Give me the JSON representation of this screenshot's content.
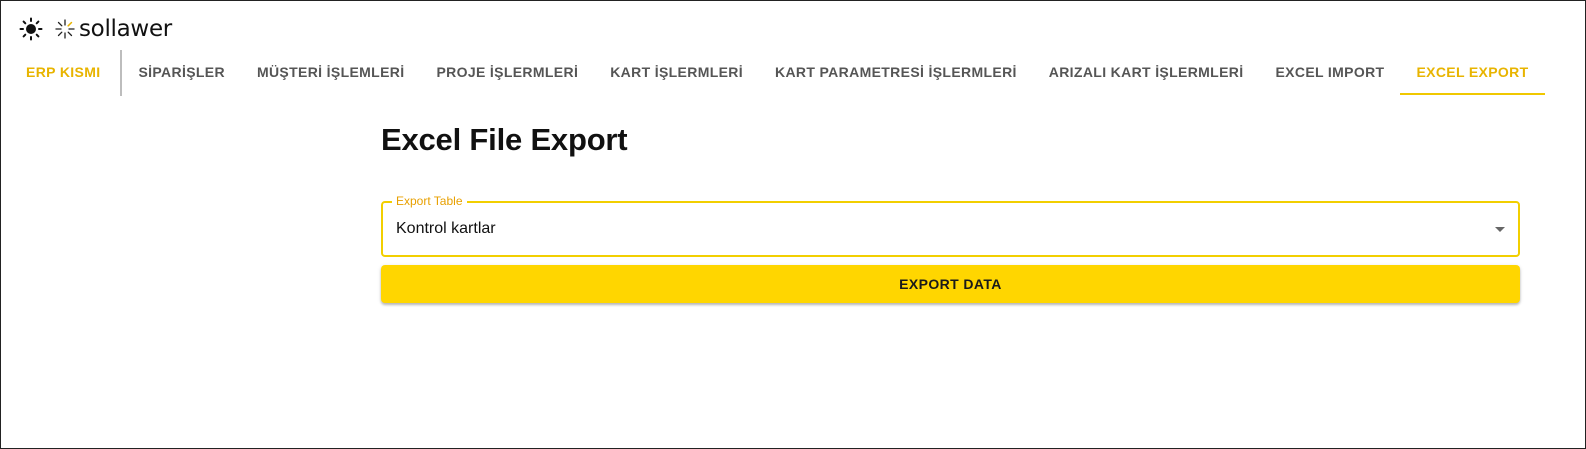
{
  "header": {
    "theme_icon": "sun-icon",
    "logo_icon": "sparkle-icon",
    "logo_text": "sollawer"
  },
  "nav": {
    "brand": "ERP KISMI",
    "tabs": [
      {
        "label": "SİPARİŞLER"
      },
      {
        "label": "MÜŞTERİ İŞLEMLERİ"
      },
      {
        "label": "PROJE İŞLERMLERİ"
      },
      {
        "label": "KART İŞLERMLERİ"
      },
      {
        "label": "KART PARAMETRESİ İŞLERMLERİ"
      },
      {
        "label": "ARIZALI KART İŞLERMLERİ"
      },
      {
        "label": "EXCEL IMPORT"
      },
      {
        "label": "EXCEL EXPORT",
        "active": true
      }
    ]
  },
  "main": {
    "title": "Excel File Export",
    "export_table": {
      "label": "Export Table",
      "value": "Kontrol kartlar",
      "icon": "arrow-drop-down-icon"
    },
    "export_button": "EXPORT DATA"
  },
  "colors": {
    "accent": "#ffd600",
    "accent_text": "#e8b400",
    "focus_border": "#f2cf00",
    "label": "#e8a000"
  }
}
